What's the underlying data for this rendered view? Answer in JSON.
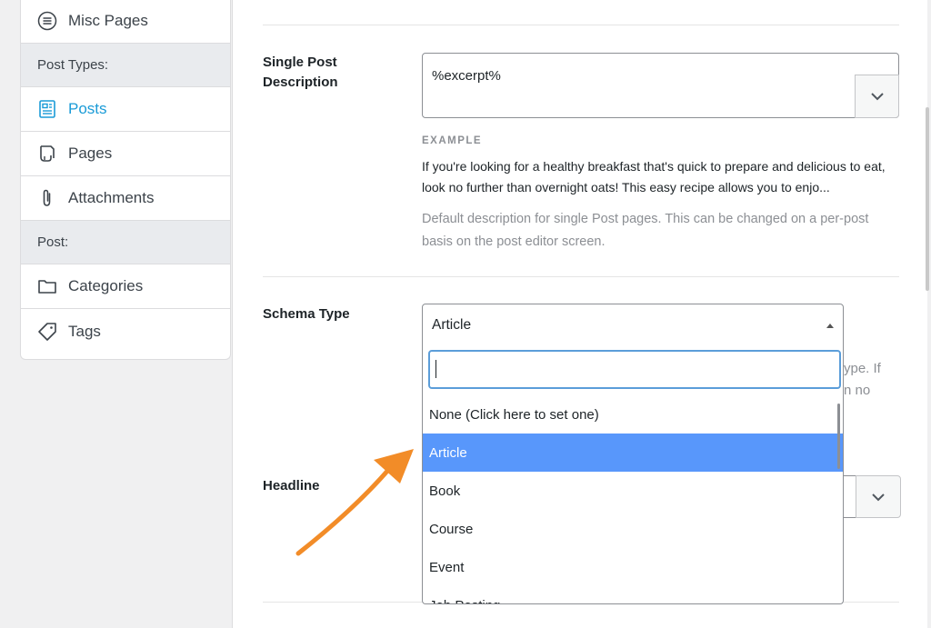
{
  "sidebar": {
    "items": [
      {
        "label": "Misc Pages",
        "icon": "list-circle-icon"
      },
      {
        "label": "Post Types:",
        "group": true
      },
      {
        "label": "Posts",
        "icon": "post-icon",
        "active": true
      },
      {
        "label": "Pages",
        "icon": "page-icon"
      },
      {
        "label": "Attachments",
        "icon": "paperclip-icon"
      },
      {
        "label": "Post:",
        "group": true
      },
      {
        "label": "Categories",
        "icon": "folder-icon"
      },
      {
        "label": "Tags",
        "icon": "tag-icon"
      }
    ]
  },
  "description": {
    "label": "Single Post Description",
    "value": "%excerpt%",
    "example_heading": "EXAMPLE",
    "example_text": "If you're looking for a healthy breakfast that's quick to prepare and delicious to eat, look no further than overnight oats! This easy recipe allows you to enjo...",
    "help": "Default description for single Post pages. This can be changed on a per-post basis on the post editor screen."
  },
  "schema": {
    "label": "Schema Type",
    "selected": "Article",
    "search_value": "",
    "options": [
      "None (Click here to set one)",
      "Article",
      "Book",
      "Course",
      "Event",
      "Job Posting"
    ],
    "highlighted": "Article",
    "hidden_text_1": "ype. If",
    "hidden_text_2": "n no"
  },
  "headline": {
    "label": "Headline"
  },
  "colors": {
    "accent": "#1a9bd7",
    "highlight": "#5897fb",
    "focus": "#5b9dd9",
    "arrow": "#f28c28"
  }
}
